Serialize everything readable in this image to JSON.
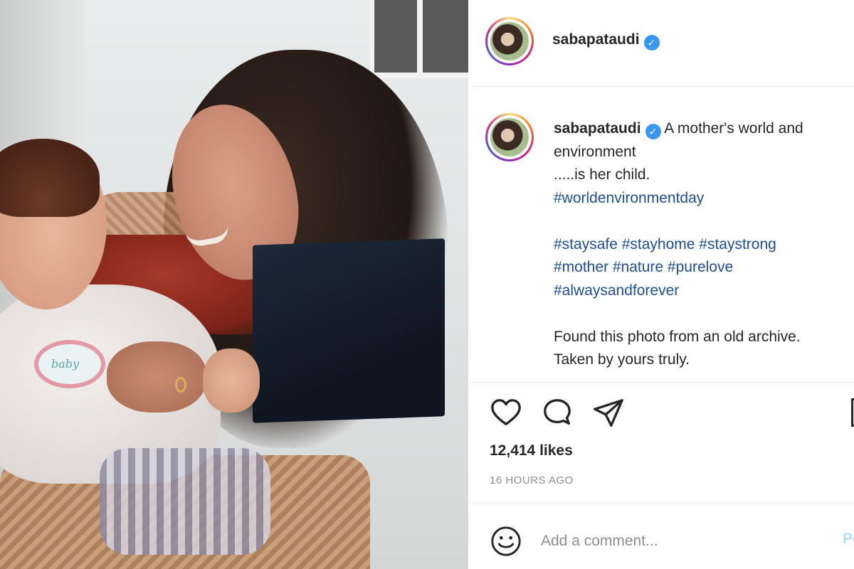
{
  "post": {
    "username": "sabapataudi",
    "verified_glyph": "✓",
    "caption": {
      "line1": "A mother's world and",
      "line2": "environment",
      "line3": ".....is her child.",
      "hashtags1": "#worldenvironmentday",
      "hashtags2": "#staysafe #stayhome #staystrong",
      "hashtags3": "#mother #nature #purelove",
      "hashtags4": "#alwaysandforever",
      "line4": "Found this photo from an old archive.",
      "line5": "Taken by yours truly."
    },
    "photo_badge_text": "baby",
    "likes": "12,414 likes",
    "time": "16 HOURS AGO",
    "comment_placeholder": "Add a comment...",
    "post_button": "Post"
  },
  "icons": {
    "like": "heart-icon",
    "comment": "comment-bubble-icon",
    "share": "paper-plane-icon",
    "save": "bookmark-icon",
    "emoji": "smiley-icon"
  },
  "colors": {
    "hashtag": "#1f4f8f",
    "verified": "#3897f0",
    "muted": "#8e8e8e",
    "post_button": "#b2dffc"
  }
}
